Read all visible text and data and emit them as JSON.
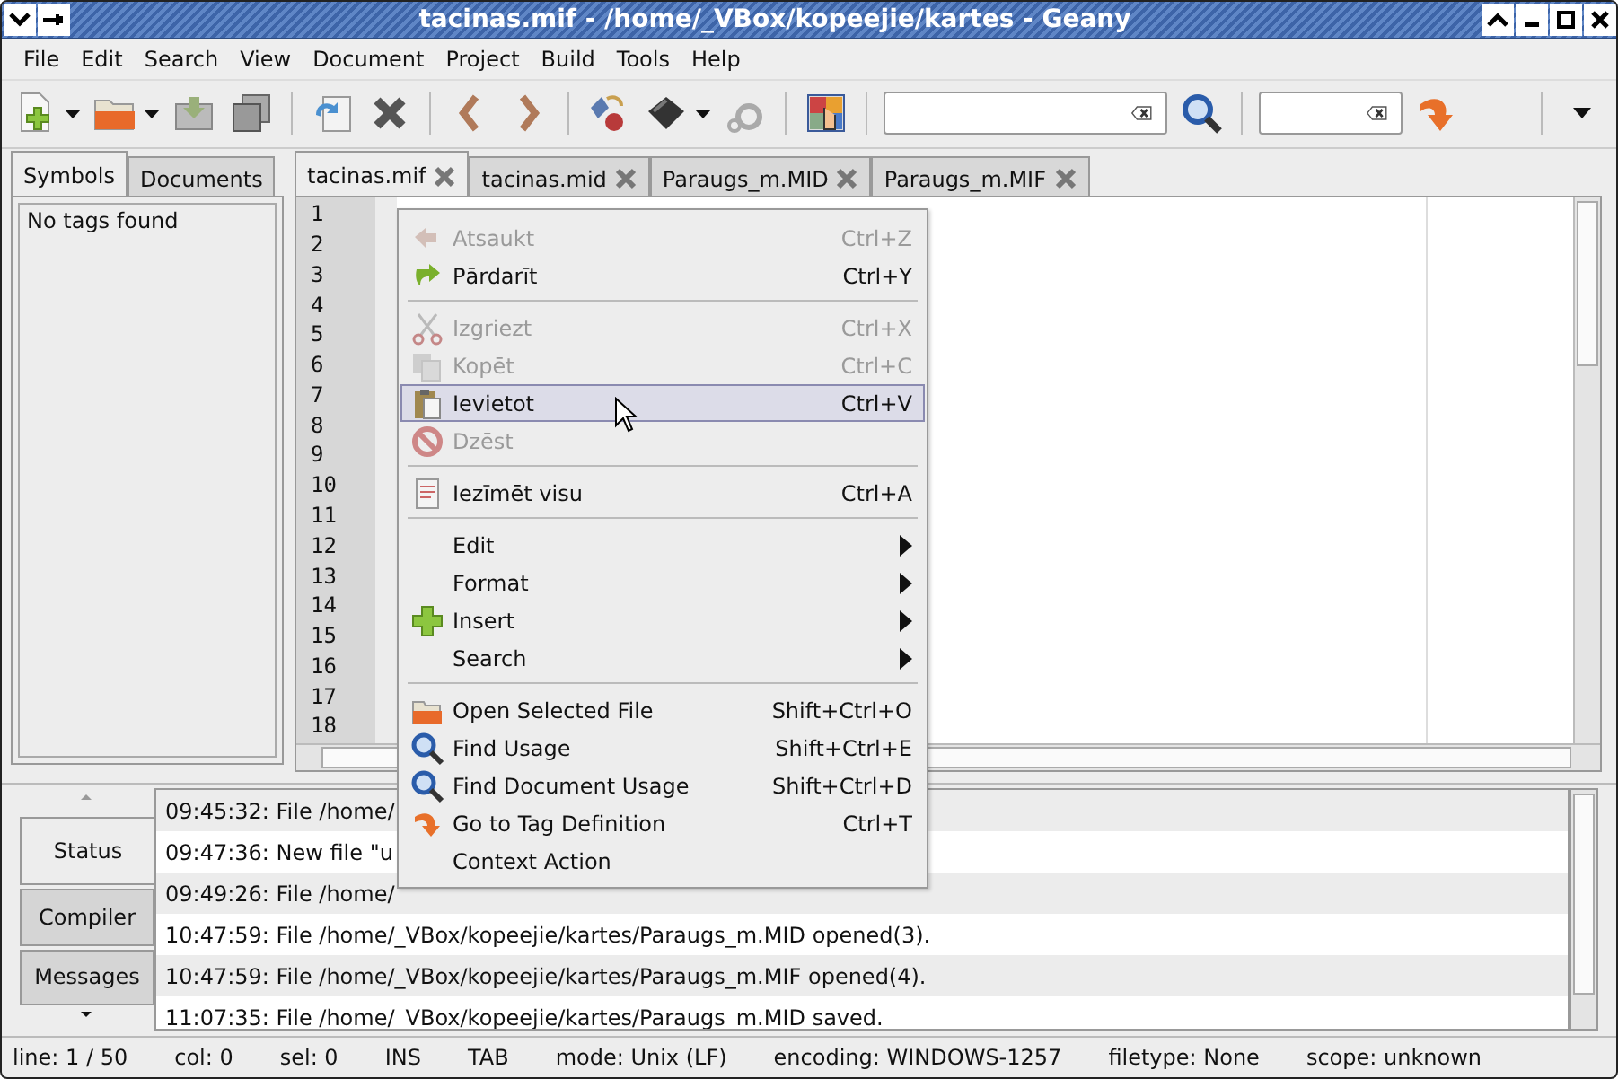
{
  "window": {
    "title": "tacinas.mif - /home/_VBox/kopeejie/kartes - Geany"
  },
  "menu_bar": [
    "File",
    "Edit",
    "Search",
    "View",
    "Document",
    "Project",
    "Build",
    "Tools",
    "Help"
  ],
  "sidebar": {
    "tabs": [
      {
        "label": "Symbols",
        "selected": true
      },
      {
        "label": "Documents",
        "selected": false
      }
    ],
    "message": "No tags found"
  },
  "editor": {
    "tabs": [
      {
        "label": "tacinas.mif",
        "selected": true
      },
      {
        "label": "tacinas.mid",
        "selected": false
      },
      {
        "label": "Paraugs_m.MID",
        "selected": false
      },
      {
        "label": "Paraugs_m.MIF",
        "selected": false
      }
    ],
    "line_numbers": [
      "1",
      "2",
      "3",
      "4",
      "5",
      "6",
      "7",
      "8",
      "9",
      "10",
      "11",
      "12",
      "13",
      "14",
      "15",
      "16",
      "17",
      "18"
    ]
  },
  "context_menu": {
    "items": [
      {
        "kind": "item",
        "label": "Atsaukt",
        "shortcut": "Ctrl+Z",
        "disabled": true,
        "selected": false
      },
      {
        "kind": "item",
        "label": "Pārdarīt",
        "shortcut": "Ctrl+Y",
        "disabled": false,
        "selected": false
      },
      {
        "kind": "separator"
      },
      {
        "kind": "item",
        "label": "Izgriezt",
        "shortcut": "Ctrl+X",
        "disabled": true,
        "selected": false
      },
      {
        "kind": "item",
        "label": "Kopēt",
        "shortcut": "Ctrl+C",
        "disabled": true,
        "selected": false
      },
      {
        "kind": "item",
        "label": "Ievietot",
        "shortcut": "Ctrl+V",
        "disabled": false,
        "selected": true
      },
      {
        "kind": "item",
        "label": "Dzēst",
        "disabled": true,
        "selected": false
      },
      {
        "kind": "separator"
      },
      {
        "kind": "item",
        "label": "Iezīmēt visu",
        "shortcut": "Ctrl+A",
        "disabled": false,
        "selected": false
      },
      {
        "kind": "separator"
      },
      {
        "kind": "submenu",
        "label": "Edit",
        "disabled": false,
        "selected": false
      },
      {
        "kind": "submenu",
        "label": "Format",
        "disabled": false,
        "selected": false
      },
      {
        "kind": "submenu",
        "label": "Insert",
        "disabled": false,
        "selected": false
      },
      {
        "kind": "submenu",
        "label": "Search",
        "disabled": false,
        "selected": false
      },
      {
        "kind": "separator"
      },
      {
        "kind": "item",
        "label": "Open Selected File",
        "shortcut": "Shift+Ctrl+O",
        "disabled": false,
        "selected": false
      },
      {
        "kind": "item",
        "label": "Find Usage",
        "shortcut": "Shift+Ctrl+E",
        "disabled": false,
        "selected": false
      },
      {
        "kind": "item",
        "label": "Find Document Usage",
        "shortcut": "Shift+Ctrl+D",
        "disabled": false,
        "selected": false
      },
      {
        "kind": "item",
        "label": "Go to Tag Definition",
        "shortcut": "Ctrl+T",
        "disabled": false,
        "selected": false
      },
      {
        "kind": "item",
        "label": "Context Action",
        "disabled": false,
        "selected": false
      }
    ]
  },
  "messages": {
    "tabs": [
      {
        "label": "Status",
        "selected": true
      },
      {
        "label": "Compiler",
        "selected": false
      },
      {
        "label": "Messages",
        "selected": false
      }
    ],
    "lines": [
      "09:45:32: File /home/",
      "09:47:36: New file \"u",
      "09:49:26: File /home/",
      "10:47:59: File /home/_VBox/kopeejie/kartes/Paraugs_m.MID opened(3).",
      "10:47:59: File /home/_VBox/kopeejie/kartes/Paraugs_m.MIF opened(4).",
      "11:07:35: File /home/_VBox/kopeejie/kartes/Paraugs_m.MID saved."
    ]
  },
  "status_bar": [
    "line: 1 / 50",
    "col: 0",
    "sel: 0",
    "INS",
    "TAB",
    "mode: Unix (LF)",
    "encoding: WINDOWS-1257",
    "filetype: None",
    "scope: unknown"
  ]
}
